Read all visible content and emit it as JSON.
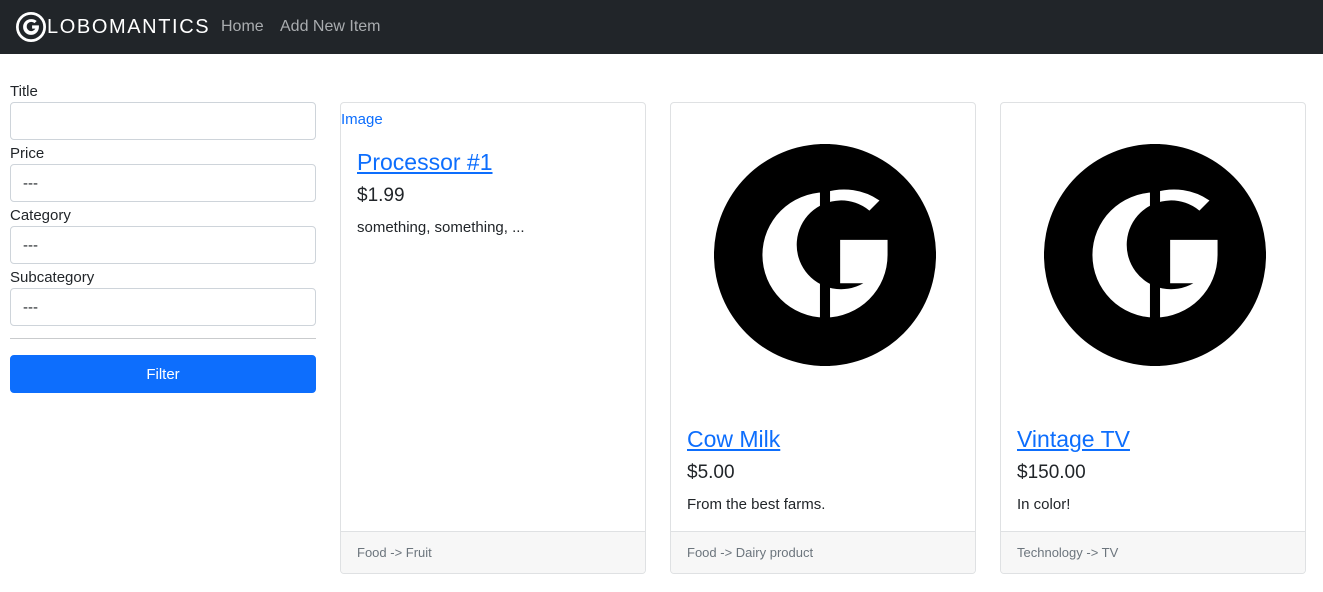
{
  "navbar": {
    "brand": "LOBOMANTICS",
    "brand_icon": "globomantics-g-logo-icon",
    "links": [
      {
        "label": "Home"
      },
      {
        "label": "Add New Item"
      }
    ]
  },
  "filter": {
    "fields": [
      {
        "label": "Title",
        "value": "",
        "placeholder": ""
      },
      {
        "label": "Price",
        "selected": "---"
      },
      {
        "label": "Category",
        "selected": "---"
      },
      {
        "label": "Subcategory",
        "selected": "---"
      }
    ],
    "button_label": "Filter"
  },
  "items": [
    {
      "image_alt": "Image",
      "title": "Processor #1",
      "price": "$1.99",
      "description": "something, something, ...",
      "category_path": "Food -> Fruit"
    },
    {
      "image_icon": "globomantics-g-logo-icon",
      "title": "Cow Milk",
      "price": "$5.00",
      "description": "From the best farms.",
      "category_path": "Food -> Dairy product"
    },
    {
      "image_icon": "globomantics-g-logo-icon",
      "title": "Vintage TV",
      "price": "$150.00",
      "description": "In color!",
      "category_path": "Technology -> TV"
    }
  ],
  "colors": {
    "navbar_bg": "#212529",
    "primary": "#0d6efd",
    "nav_link": "#a9acaf",
    "card_footer_bg": "#f7f7f7"
  }
}
